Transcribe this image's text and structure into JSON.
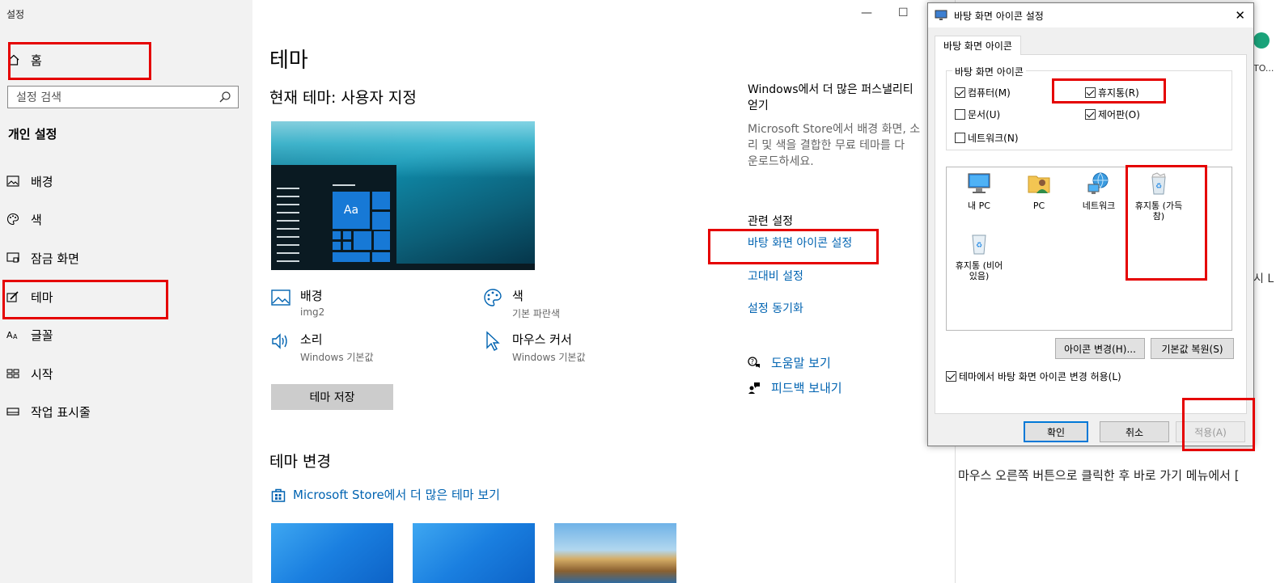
{
  "settings": {
    "window_title": "설정",
    "home_label": "홈",
    "search_placeholder": "설정 검색",
    "section_label": "개인 설정",
    "nav_items": [
      {
        "label": "배경",
        "icon": "picture-icon"
      },
      {
        "label": "색",
        "icon": "palette-icon"
      },
      {
        "label": "잠금 화면",
        "icon": "lock-screen-icon"
      },
      {
        "label": "테마",
        "icon": "theme-brush-icon"
      },
      {
        "label": "글꼴",
        "icon": "font-icon"
      },
      {
        "label": "시작",
        "icon": "start-grid-icon"
      },
      {
        "label": "작업 표시줄",
        "icon": "taskbar-icon"
      }
    ]
  },
  "main": {
    "title": "테마",
    "current_theme": "현재 테마: 사용자 지정",
    "preview_tile_label": "Aa",
    "props": [
      {
        "label": "배경",
        "value": "img2",
        "icon": "picture-icon"
      },
      {
        "label": "색",
        "value": "기본 파란색",
        "icon": "palette-icon"
      },
      {
        "label": "소리",
        "value": "Windows 기본값",
        "icon": "speaker-icon"
      },
      {
        "label": "마우스 커서",
        "value": "Windows 기본값",
        "icon": "cursor-icon"
      }
    ],
    "save_button": "테마 저장",
    "change_theme": "테마 변경",
    "store_link": "Microsoft Store에서 더 많은 테마 보기",
    "right": {
      "heading_line1": "Windows에서 더 많은 퍼스낼리티",
      "heading_line2": "얻기",
      "desc_line1": "Microsoft Store에서 배경 화면, 소",
      "desc_line2": "리 및 색을 결합한 무료 테마를 다",
      "desc_line3": "운로드하세요.",
      "related_title": "관련 설정",
      "links": [
        "바탕 화면 아이콘 설정",
        "고대비 설정",
        "설정 동기화"
      ],
      "help": "도움말 보기",
      "feedback": "피드백 보내기"
    },
    "min_glyph": "—",
    "max_glyph": "☐"
  },
  "dialog": {
    "title": "바탕 화면 아이콘 설정",
    "close_glyph": "✕",
    "tab": "바탕 화면 아이콘",
    "group_label": "바탕 화면 아이콘",
    "checkboxes": [
      {
        "label": "컴퓨터(M)",
        "checked": true
      },
      {
        "label": "휴지통(R)",
        "checked": true
      },
      {
        "label": "문서(U)",
        "checked": false
      },
      {
        "label": "제어판(O)",
        "checked": true
      },
      {
        "label": "네트워크(N)",
        "checked": false
      }
    ],
    "icons": [
      {
        "label_line1": "내 PC",
        "label_line2": "",
        "icon": "monitor-icon"
      },
      {
        "label_line1": "PC",
        "label_line2": "",
        "icon": "user-folder-icon"
      },
      {
        "label_line1": "네트워크",
        "label_line2": "",
        "icon": "network-globe-icon"
      },
      {
        "label_line1": "휴지통 (가득",
        "label_line2": "참)",
        "icon": "recycle-bin-full-icon"
      },
      {
        "label_line1": "휴지통 (비어",
        "label_line2": "있음)",
        "icon": "recycle-bin-empty-icon"
      }
    ],
    "change_icon_button": "아이콘 변경(H)...",
    "restore_button": "기본값 복원(S)",
    "allow_theme_label": "테마에서 바탕 화면 아이콘 변경 허용(L)",
    "allow_theme_checked": true,
    "ok_button": "확인",
    "cancel_button": "취소",
    "apply_button": "적용(A)"
  },
  "background_doc": {
    "line": "마우스 오른쪽 버튼으로 클릭한 후 바로 가기 메뉴에서 [",
    "side_glyph": "시 L",
    "side_text": "TO..."
  },
  "colors": {
    "accent": "#0063b1",
    "annotation": "#e50000",
    "sidebar_bg": "#f2f2f2"
  }
}
